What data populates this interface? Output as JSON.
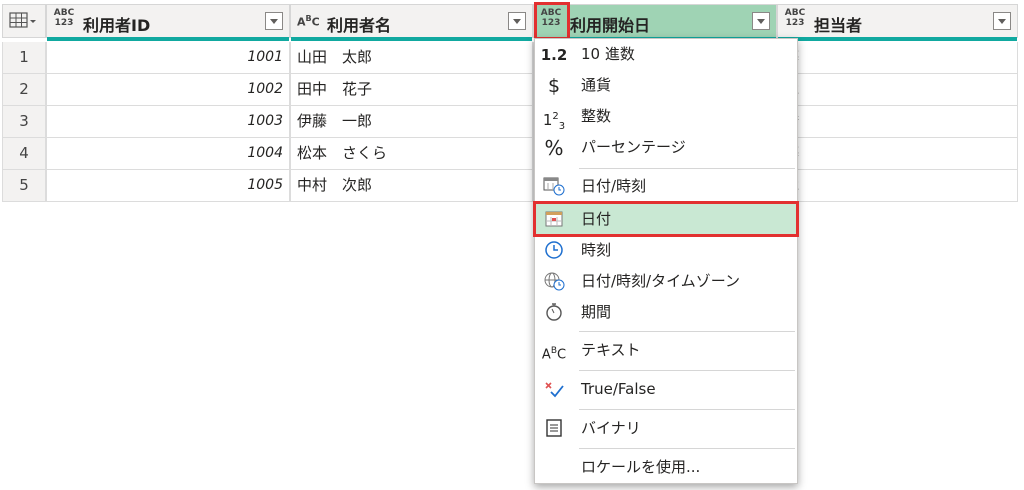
{
  "table": {
    "columns": [
      {
        "type_label": "ABC\n123",
        "name": "利用者ID"
      },
      {
        "type_label": "A B C",
        "name": "利用者名"
      },
      {
        "type_label": "ABC\n123",
        "name": "利用開始日"
      },
      {
        "type_label": "ABC\n123",
        "name": "担当者"
      }
    ],
    "rows": [
      {
        "num": "1",
        "id": "1001",
        "name": "山田　太郎",
        "tanto": "藤"
      },
      {
        "num": "2",
        "id": "1002",
        "name": "田中　花子",
        "tanto": "木"
      },
      {
        "num": "3",
        "id": "1003",
        "name": "伊藤　一郎",
        "tanto": "橋"
      },
      {
        "num": "4",
        "id": "1004",
        "name": "松本　さくら",
        "tanto": "藤"
      },
      {
        "num": "5",
        "id": "1005",
        "name": "中村　次郎",
        "tanto": "木"
      }
    ]
  },
  "type_menu": {
    "items": [
      {
        "icon": "1.2",
        "label": "10 進数"
      },
      {
        "icon": "$",
        "label": "通貨"
      },
      {
        "icon": "1²3",
        "label": "整数"
      },
      {
        "icon": "%",
        "label": "パーセンテージ"
      },
      {
        "icon": "datetime",
        "label": "日付/時刻"
      },
      {
        "icon": "date",
        "label": "日付"
      },
      {
        "icon": "time",
        "label": "時刻"
      },
      {
        "icon": "globe",
        "label": "日付/時刻/タイムゾーン"
      },
      {
        "icon": "timer",
        "label": "期間"
      },
      {
        "icon": "ABC",
        "label": "テキスト"
      },
      {
        "icon": "check",
        "label": "True/False"
      },
      {
        "icon": "binary",
        "label": "バイナリ"
      },
      {
        "icon": "",
        "label": "ロケールを使用..."
      }
    ],
    "selected": "日付"
  },
  "colors": {
    "accent": "#11a9a0",
    "selected_header": "#9fd3b4",
    "highlight": "#c9e8d3",
    "callout": "#e23030"
  }
}
